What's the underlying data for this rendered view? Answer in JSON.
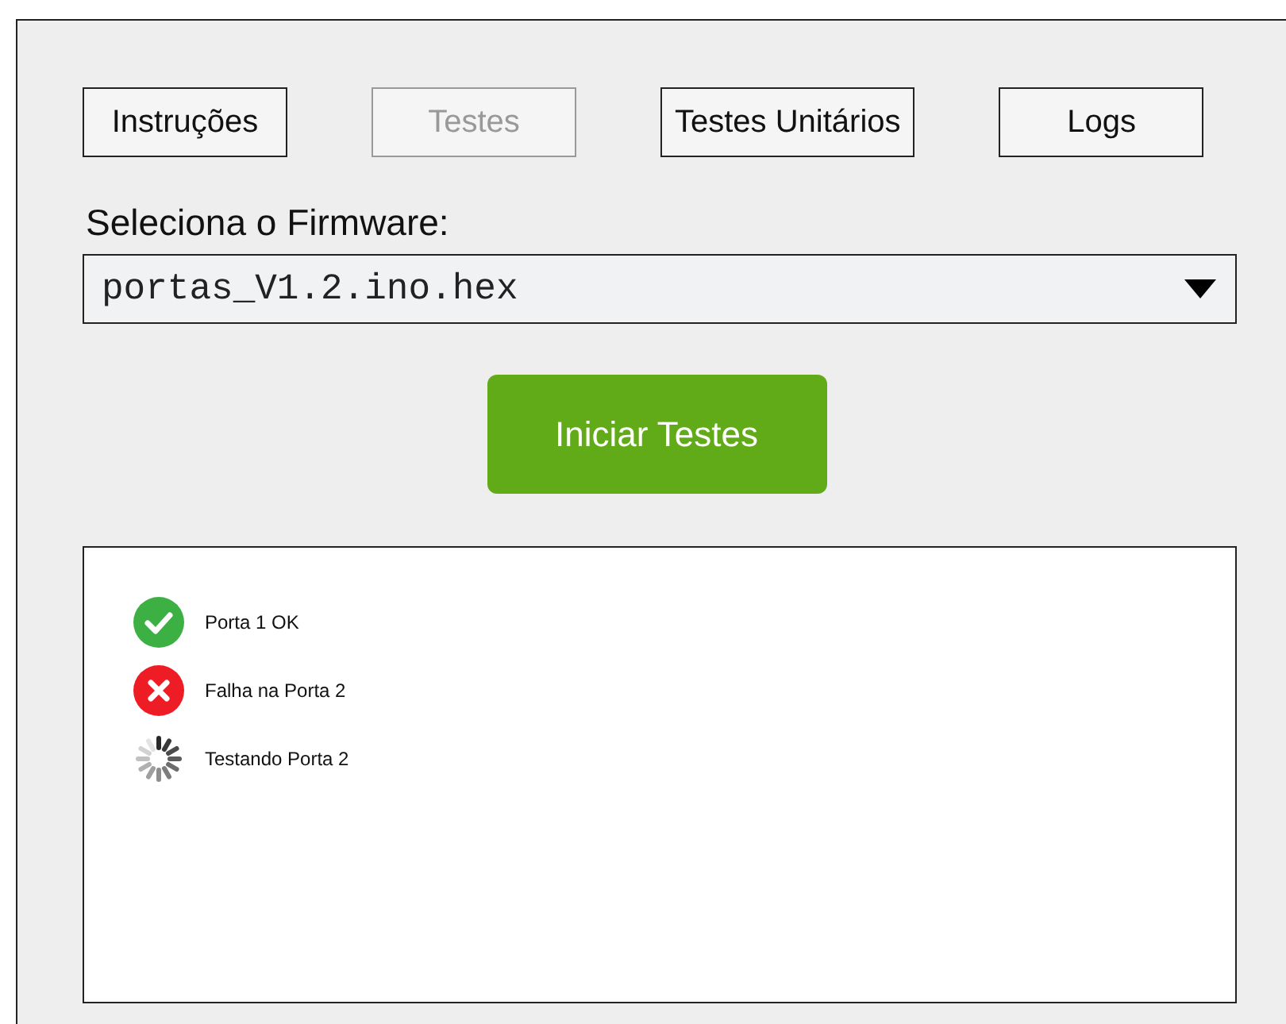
{
  "tabs": [
    {
      "label": "Instruções",
      "disabled": false
    },
    {
      "label": "Testes",
      "disabled": true
    },
    {
      "label": "Testes Unitários",
      "disabled": false
    },
    {
      "label": "Logs",
      "disabled": false
    }
  ],
  "firmware": {
    "label": "Seleciona o Firmware:",
    "value": "portas_V1.2.ino.hex"
  },
  "start_button": "Iniciar Testes",
  "log": [
    {
      "kind": "ok",
      "text": "Porta 1 OK"
    },
    {
      "kind": "fail",
      "text": "Falha na Porta 2"
    },
    {
      "kind": "running",
      "text": "Testando Porta 2"
    }
  ]
}
